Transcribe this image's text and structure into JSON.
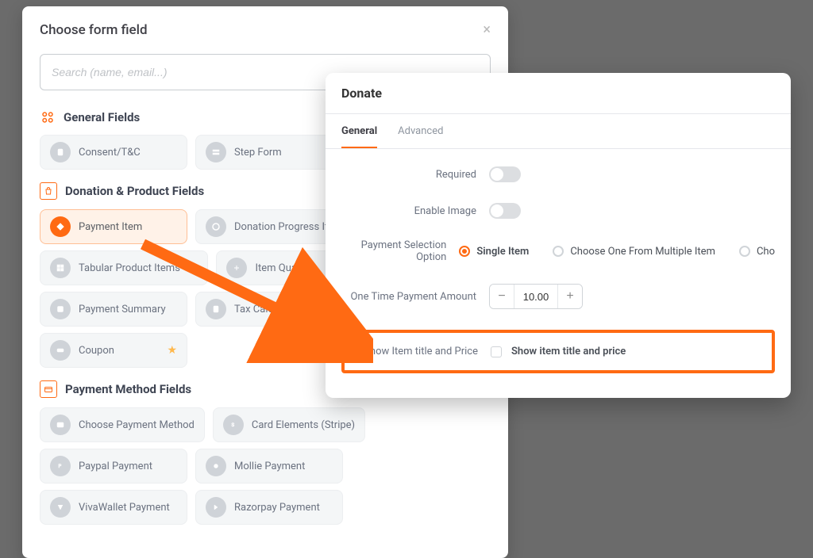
{
  "modal": {
    "title": "Choose form field",
    "search_placeholder": "Search (name, email...)",
    "sections": {
      "general": {
        "title": "General Fields"
      },
      "donation": {
        "title": "Donation & Product Fields"
      },
      "payment_method": {
        "title": "Payment Method Fields"
      }
    },
    "general_chips": [
      {
        "label": "Consent/T&C"
      },
      {
        "label": "Step Form"
      }
    ],
    "donation_chips": {
      "payment_item": "Payment Item",
      "donation_progress": "Donation Progress Item",
      "tabular": "Tabular Product Items",
      "qty": "Item Quantity",
      "summary": "Payment Summary",
      "tax": "Tax Calculated Amount",
      "coupon": "Coupon"
    },
    "payment_chips": {
      "choose": "Choose Payment Method",
      "card": "Card Elements (Stripe)",
      "paypal": "Paypal Payment",
      "mollie": "Mollie Payment",
      "viva": "VivaWallet Payment",
      "razor": "Razorpay Payment"
    }
  },
  "donate": {
    "title": "Donate",
    "tabs": {
      "general": "General",
      "advanced": "Advanced"
    },
    "labels": {
      "required": "Required",
      "enable_image": "Enable Image",
      "selection": "Payment Selection Option",
      "one_time": "One Time Payment Amount",
      "show_item": "Show Item title and Price"
    },
    "radios": {
      "single": "Single Item",
      "multiple": "Choose One From Multiple Item",
      "cho": "Cho"
    },
    "amount": "10.00",
    "checkbox_label": "Show item title and price"
  }
}
